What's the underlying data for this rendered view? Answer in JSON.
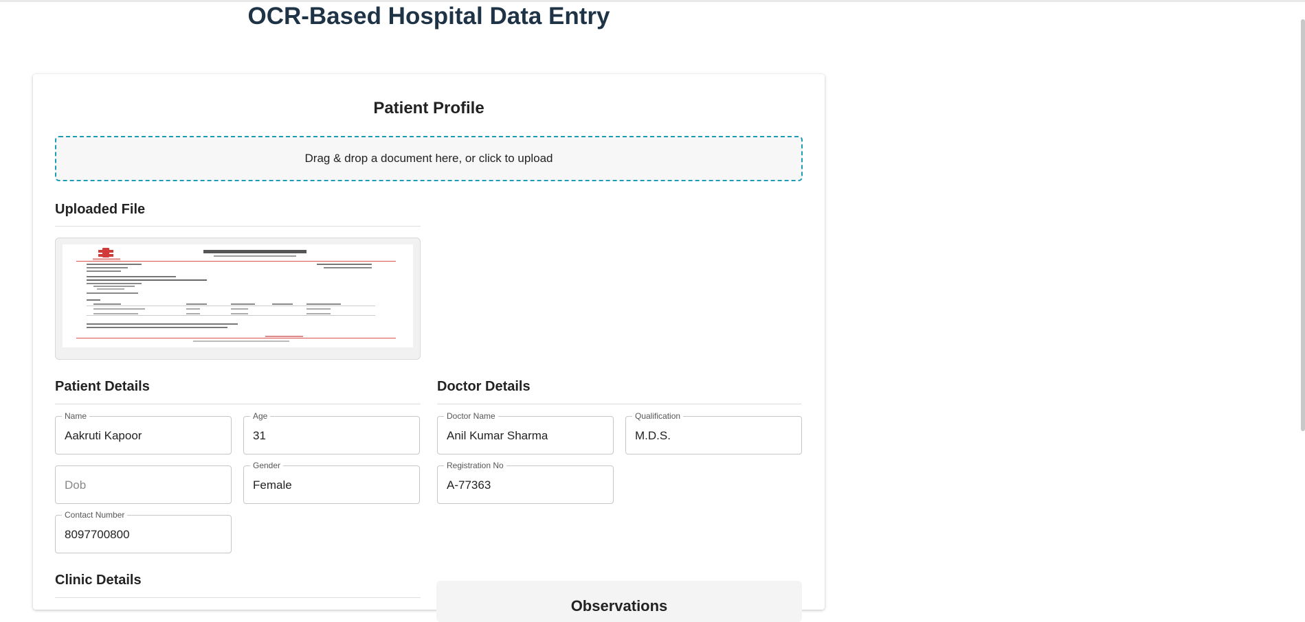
{
  "app": {
    "title": "OCR-Based Hospital Data Entry"
  },
  "profile": {
    "title": "Patient Profile",
    "upload_prompt": "Drag & drop a document here, or click to upload",
    "uploaded_file_heading": "Uploaded File"
  },
  "patient": {
    "heading": "Patient Details",
    "name": {
      "label": "Name",
      "value": "Aakruti Kapoor"
    },
    "age": {
      "label": "Age",
      "value": "31"
    },
    "dob": {
      "placeholder": "Dob",
      "value": ""
    },
    "gender": {
      "label": "Gender",
      "value": "Female"
    },
    "contact": {
      "label": "Contact Number",
      "value": "8097700800"
    }
  },
  "doctor": {
    "heading": "Doctor Details",
    "name": {
      "label": "Doctor Name",
      "value": "Anil Kumar Sharma"
    },
    "qualification": {
      "label": "Qualification",
      "value": "M.D.S."
    },
    "registration": {
      "label": "Registration No",
      "value": "A-77363"
    }
  },
  "clinic": {
    "heading": "Clinic Details"
  },
  "observations": {
    "heading": "Observations"
  },
  "colors": {
    "accent": "#1b9bb4",
    "title": "#1f3347"
  }
}
